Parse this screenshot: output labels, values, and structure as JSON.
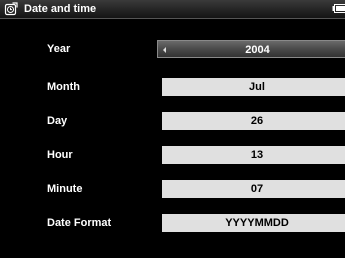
{
  "header": {
    "title": "Date and time",
    "icon": "clock-icon",
    "battery_icon": "battery-icon"
  },
  "rows": [
    {
      "label": "Year",
      "value": "2004",
      "selected": true
    },
    {
      "label": "Month",
      "value": "Jul",
      "selected": false
    },
    {
      "label": "Day",
      "value": "26",
      "selected": false
    },
    {
      "label": "Hour",
      "value": "13",
      "selected": false
    },
    {
      "label": "Minute",
      "value": "07",
      "selected": false
    },
    {
      "label": "Date Format",
      "value": "YYYYMMDD",
      "selected": false
    }
  ],
  "colors": {
    "background": "#000000",
    "field": "#e0e0e0",
    "selected_field": "#4a4a4a"
  }
}
